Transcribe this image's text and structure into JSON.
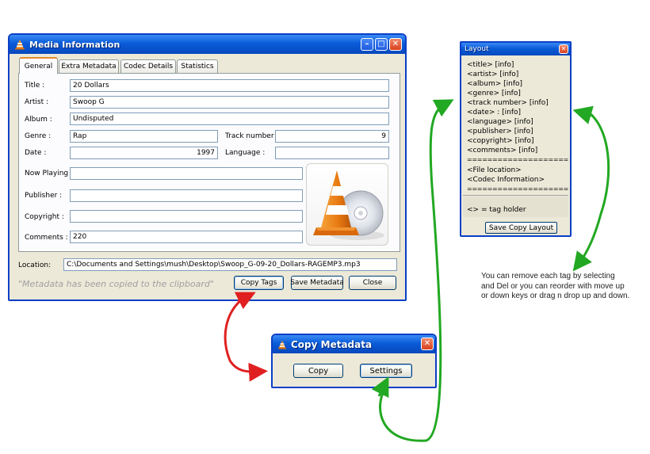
{
  "media_window": {
    "title": "Media Information",
    "tabs": [
      "General",
      "Extra Metadata",
      "Codec Details",
      "Statistics"
    ],
    "fields": {
      "title": {
        "label": "Title :",
        "value": "20 Dollars"
      },
      "artist": {
        "label": "Artist :",
        "value": "Swoop G"
      },
      "album": {
        "label": "Album :",
        "value": "Undisputed"
      },
      "genre": {
        "label": "Genre :",
        "value": "Rap"
      },
      "track": {
        "label": "Track number :",
        "value": "9"
      },
      "date": {
        "label": "Date :",
        "value": "1997"
      },
      "language": {
        "label": "Language :",
        "value": ""
      },
      "now_playing": {
        "label": "Now Playing :",
        "value": ""
      },
      "publisher": {
        "label": "Publisher :",
        "value": ""
      },
      "copyright": {
        "label": "Copyright :",
        "value": ""
      },
      "comments": {
        "label": "Comments :",
        "value": "220"
      }
    },
    "location": {
      "label": "Location:",
      "value": "C:\\Documents and Settings\\mush\\Desktop\\Swoop_G-09-20_Dollars-RAGEMP3.mp3"
    },
    "status_message": "\"Metadata has been copied to the clipboard\"",
    "buttons": {
      "copy_tags": "Copy Tags",
      "save_metadata": "Save Metadata",
      "close": "Close"
    },
    "window_controls": {
      "minimize": "–",
      "maximize": "□",
      "close": "✕"
    }
  },
  "layout_window": {
    "title": "Layout",
    "close": "✕",
    "tags": [
      "<title>  [info]",
      "<artist>  [info]",
      "<album>  [info]",
      "<genre>  [info]",
      "<track number>  [info]",
      "<date> : [info]",
      "<language>  [info]",
      "<publisher>  [info]",
      "<copyright>  [info]",
      "<comments>  [info]",
      "====================",
      "<File location>",
      "<Codec Information>",
      "===================="
    ],
    "legend": "<> = tag holder",
    "save_button": "Save Copy Layout"
  },
  "copy_window": {
    "title": "Copy Metadata",
    "close": "✕",
    "buttons": {
      "copy": "Copy",
      "settings": "Settings"
    }
  },
  "note": {
    "lines": [
      "You can remove each tag by selecting",
      "and Del or you can reorder with move up",
      "or down keys or drag n drop up and down."
    ]
  },
  "colors": {
    "titlebar": "#0a5bd8",
    "window_bg": "#ece9d8",
    "arrow_red": "#e02020",
    "arrow_green": "#22a822",
    "tab_accent": "#e68b2c"
  }
}
